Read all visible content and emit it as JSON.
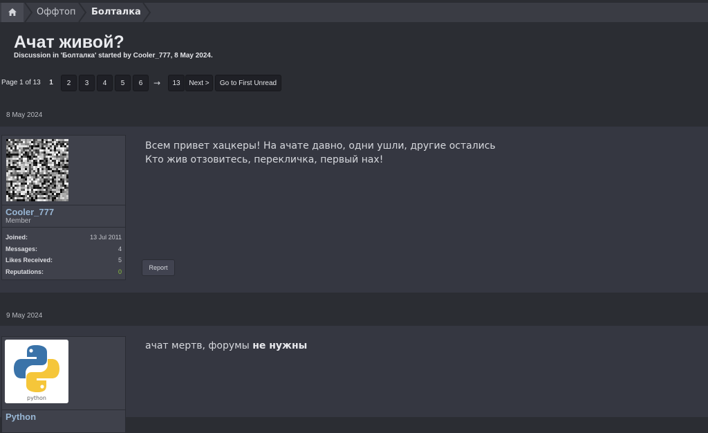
{
  "breadcrumbs": {
    "home_icon": "home-icon",
    "items": [
      "Оффтоп",
      "Болталка"
    ]
  },
  "thread": {
    "title": "Ачат живой?",
    "meta": "Discussion in 'Болталка' started by Cooler_777, 8 May 2024."
  },
  "pagination": {
    "info": "Page 1 of 13",
    "current": "1",
    "pages": [
      "2",
      "3",
      "4",
      "5",
      "6"
    ],
    "arrow": "→",
    "last": "13",
    "next": "Next >",
    "first_unread": "Go to First Unread"
  },
  "posts": [
    {
      "date": "8 May 2024",
      "user": {
        "name": "Cooler_777",
        "title": "Member",
        "avatar_icon": "static-noise-avatar",
        "stats": [
          {
            "label": "Joined:",
            "value": "13 Jul 2011"
          },
          {
            "label": "Messages:",
            "value": "4"
          },
          {
            "label": "Likes Received:",
            "value": "5"
          },
          {
            "label": "Reputations:",
            "value": "0"
          }
        ]
      },
      "lines": [
        "Всем привет хацкеры! На ачате давно, одни ушли, другие остались",
        "Кто жив отзовитесь, перекличка, первый нах!"
      ],
      "report": "Report"
    },
    {
      "date": "9 May 2024",
      "user": {
        "name": "Python",
        "avatar_icon": "python-logo",
        "avatar_caption": "python"
      },
      "text_plain": "ачат мертв, форумы ",
      "text_bold": "не нужны"
    }
  ],
  "colors": {
    "background": "#2b2d33",
    "post_bg": "#353741",
    "username": "#98b6d4",
    "reputation_zero": "#8ec63f"
  }
}
